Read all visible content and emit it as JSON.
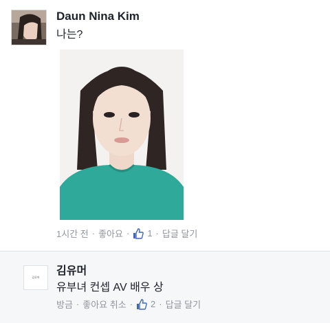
{
  "post": {
    "author": "Daun Nina Kim",
    "text": "나는?",
    "meta": {
      "time": "1시간 전",
      "like_label": "좋아요",
      "like_count": "1",
      "reply_label": "답글 달기"
    }
  },
  "reply": {
    "avatar_text": "김유머",
    "author": "김유머",
    "text": "유부녀 컨셉 AV 배우 상",
    "meta": {
      "time": "방금",
      "unlike_label": "좋아요 취소",
      "like_count": "2",
      "reply_label": "답글 달기"
    }
  },
  "colors": {
    "like_blue": "#4267b2",
    "meta_gray": "#90949c",
    "reply_bg": "#f6f7f9",
    "sweater": "#2fa999"
  },
  "icons": {
    "like": "thumbs-up-icon"
  }
}
